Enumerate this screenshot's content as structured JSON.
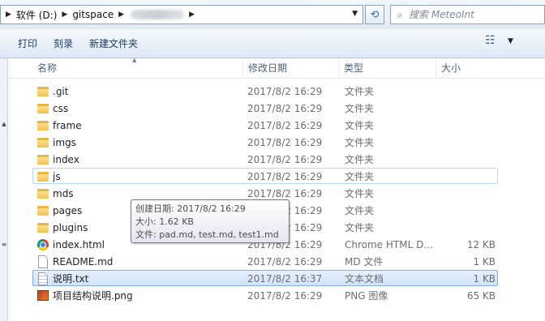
{
  "address": {
    "drive": "软件 (D:)",
    "folder": "gitspace",
    "redacted": "",
    "search_placeholder": "搜索 MeteoInt"
  },
  "toolbar": {
    "print": "打印",
    "burn": "刻录",
    "new_folder": "新建文件夹"
  },
  "columns": {
    "name": "名称",
    "date": "修改日期",
    "type": "类型",
    "size": "大小"
  },
  "files": [
    {
      "icon": "folder-icon",
      "name": ".git",
      "date": "2017/8/2 16:29",
      "type": "文件夹",
      "size": ""
    },
    {
      "icon": "folder-icon",
      "name": "css",
      "date": "2017/8/2 16:29",
      "type": "文件夹",
      "size": ""
    },
    {
      "icon": "folder-icon",
      "name": "frame",
      "date": "2017/8/2 16:29",
      "type": "文件夹",
      "size": ""
    },
    {
      "icon": "folder-icon",
      "name": "imgs",
      "date": "2017/8/2 16:29",
      "type": "文件夹",
      "size": ""
    },
    {
      "icon": "folder-icon",
      "name": "index",
      "date": "2017/8/2 16:29",
      "type": "文件夹",
      "size": ""
    },
    {
      "icon": "folder-icon",
      "name": "js",
      "date": "2017/8/2 16:29",
      "type": "文件夹",
      "size": "",
      "state": "hover"
    },
    {
      "icon": "folder-icon",
      "name": "mds",
      "date": "2017/8/2 16:29",
      "type": "文件夹",
      "size": ""
    },
    {
      "icon": "folder-icon",
      "name": "pages",
      "date": "2017/8/2 16:29",
      "type": "文件夹",
      "size": ""
    },
    {
      "icon": "folder-icon",
      "name": "plugins",
      "date": "2017/8/2 16:29",
      "type": "文件夹",
      "size": ""
    },
    {
      "icon": "chrome-html-icon",
      "name": "index.html",
      "date": "2017/8/2 16:29",
      "type": "Chrome HTML D...",
      "size": "12 KB"
    },
    {
      "icon": "md-file-icon",
      "name": "README.md",
      "date": "2017/8/2 16:29",
      "type": "MD 文件",
      "size": "1 KB"
    },
    {
      "icon": "text-file-icon",
      "name": "说明.txt",
      "date": "2017/8/2 16:37",
      "type": "文本文档",
      "size": "1 KB",
      "state": "selected"
    },
    {
      "icon": "png-image-icon",
      "name": "项目结构说明.png",
      "date": "2017/8/2 16:29",
      "type": "PNG 图像",
      "size": "65 KB"
    }
  ],
  "tooltip": {
    "created": "创建日期: 2017/8/2 16:29",
    "size": "大小: 1.62 KB",
    "files": "文件: pad.md, test.md, test1.md"
  }
}
